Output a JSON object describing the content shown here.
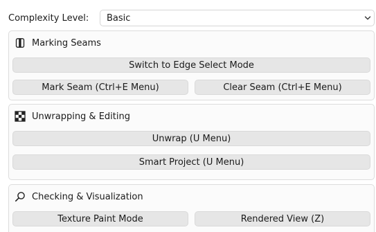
{
  "complexity": {
    "label": "Complexity Level:",
    "selected": "Basic"
  },
  "panels": [
    {
      "title": "Marking Seams",
      "icon": "seam-marker-icon",
      "buttons": [
        "Switch to Edge Select Mode",
        "Mark Seam (Ctrl+E Menu)",
        "Clear Seam (Ctrl+E Menu)"
      ]
    },
    {
      "title": "Unwrapping & Editing",
      "icon": "checker-texture-icon",
      "buttons": [
        "Unwrap (U Menu)",
        "Smart Project (U Menu)"
      ]
    },
    {
      "title": "Checking & Visualization",
      "icon": "magnifier-icon",
      "buttons": [
        "Texture Paint Mode",
        "Rendered View (Z)"
      ]
    }
  ],
  "colors": {
    "button_bg": "#e6e6e6",
    "panel_bg": "#fbfbfb",
    "border": "#dcdcdc",
    "text": "#1a1a1a"
  }
}
